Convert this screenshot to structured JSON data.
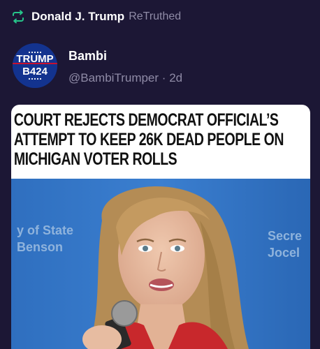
{
  "retruth": {
    "icon": "retruth-icon",
    "user_name": "Donald J. Trump",
    "action_label": "ReTruthed",
    "accent_color": "#27c48a"
  },
  "post": {
    "avatar": {
      "icon": "trump-b424-avatar",
      "text_top": "TRUMP",
      "text_bottom": "B424"
    },
    "display_name": "Bambi",
    "handle": "@BambiTrumper",
    "separator": "·",
    "age": "2d"
  },
  "media": {
    "headline_lines": [
      "COURT REJECTS DEMOCRAT OFFICIAL’S",
      "ATTEMPT TO KEEP 26K DEAD PEOPLE ON",
      "MICHIGAN VOTER ROLLS"
    ],
    "backdrop_left_lines": [
      "y of State",
      "Benson"
    ],
    "backdrop_right_lines": [
      "Secre",
      "Jocel"
    ]
  }
}
